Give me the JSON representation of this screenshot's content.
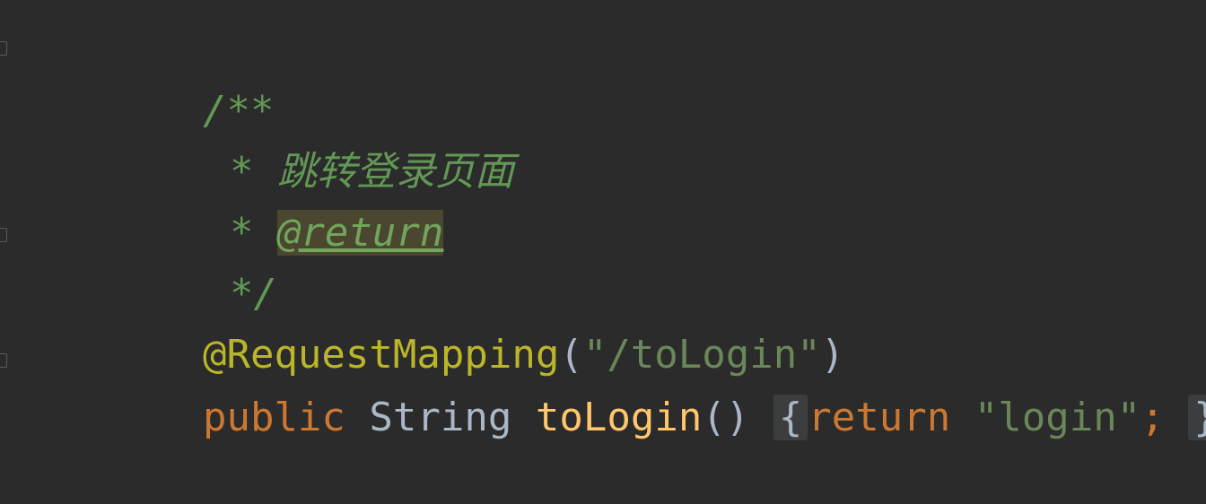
{
  "code": {
    "line1": "/**",
    "line2_star": "* ",
    "line2_text": "跳转登录页面",
    "line3_star": "* ",
    "line3_tag": "@return",
    "line4": "*/",
    "line5_annotation": "@RequestMapping",
    "line5_paren_open": "(",
    "line5_string": "\"/toLogin\"",
    "line5_paren_close": ")",
    "line6_keyword": "public",
    "line6_type": "String",
    "line6_method": "toLogin",
    "line6_parens": "()",
    "line6_brace_open": "{",
    "line6_return": "return",
    "line6_string": "\"login\"",
    "line6_semicolon": ";",
    "line6_brace_close": "}"
  },
  "colors": {
    "background": "#2b2b2b",
    "comment": "#629755",
    "annotation": "#bbb529",
    "string": "#6a8759",
    "keyword": "#cc7832",
    "method": "#ffc66d",
    "text": "#a9b7c6"
  }
}
